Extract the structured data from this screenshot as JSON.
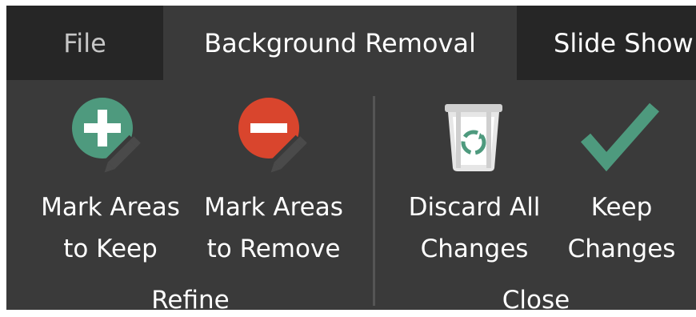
{
  "tabs": {
    "file": "File",
    "background_removal": "Background Removal",
    "slide_show": "Slide Show"
  },
  "refine": {
    "label": "Refine",
    "mark_keep": {
      "line1": "Mark Areas",
      "line2": "to Keep",
      "icon": "plus-pencil-icon",
      "color": "#4e9a7e"
    },
    "mark_remove": {
      "line1": "Mark Areas",
      "line2": "to Remove",
      "icon": "minus-pencil-icon",
      "color": "#d9452d"
    }
  },
  "close": {
    "label": "Close",
    "discard": {
      "line1": "Discard All",
      "line2": "Changes",
      "icon": "trash-recycle-icon",
      "color": "#4e9a7e"
    },
    "keep": {
      "line1": "Keep",
      "line2": "Changes",
      "icon": "checkmark-icon",
      "color": "#4e9a7e"
    }
  }
}
